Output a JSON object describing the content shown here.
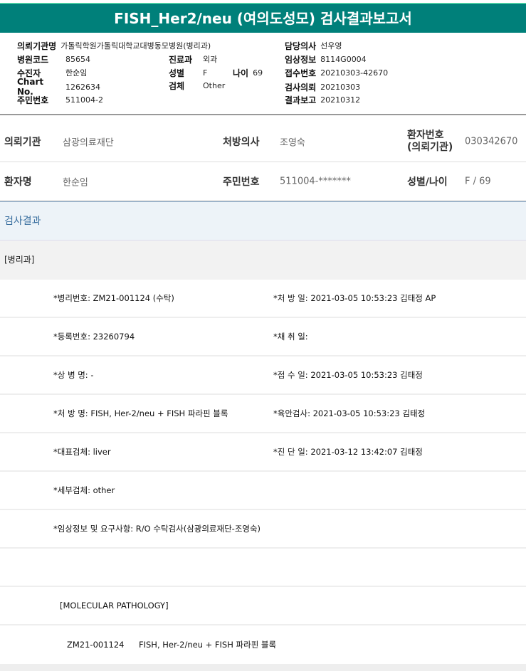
{
  "title": "FISH_Her2/neu (여의도성모) 검사결과보고서",
  "info": {
    "hospital_name_label": "의뢰기관명",
    "hospital_name": "가톨릭학원가톨릭대학교대병동모병원(병리과)",
    "hospital_code_label": "병원코드",
    "hospital_code": "85654",
    "patient_label": "수진자",
    "patient": "한순임",
    "chart_label": "Chart No.",
    "chart": "1262634",
    "rrn_label": "주민번호",
    "rrn": "511004-2",
    "dept_label": "진료과",
    "dept": "외과",
    "sex_label": "성별",
    "sex": "F",
    "age_label": "나이",
    "age": "69",
    "specimen_label": "검체",
    "specimen": "Other",
    "doctor_label": "담당의사",
    "doctor": "선우영",
    "clinical_label": "임상정보",
    "clinical": "8114G0004",
    "receipt_label": "접수번호",
    "receipt": "20210303-42670",
    "request_label": "검사의뢰",
    "request": "20210303",
    "report_label": "결과보고",
    "report": "20210312"
  },
  "patient": {
    "org_label": "의뢰기관",
    "org": "삼광의료재단",
    "presc_label": "처방의사",
    "presc": "조영숙",
    "pno_label1": "환자번호",
    "pno_label2": "(의뢰기관)",
    "pno": "030342670",
    "name_label": "환자명",
    "name": "한순임",
    "rrn_label": "주민번호",
    "rrn": "511004-*******",
    "sexage_label": "성별/나이",
    "sexage": "F / 69"
  },
  "section": "검사결과",
  "department": "[병리과]",
  "rows": [
    {
      "left": "*병리번호: ZM21-001124 (수탁)",
      "right": "*처 방 일: 2021-03-05 10:53:23  김태정 AP"
    },
    {
      "left": "*등록번호: 23260794",
      "right": "*채 취 일:"
    },
    {
      "left": "*상 병 명: -",
      "right": "*접 수 일: 2021-03-05 10:53:23  김태정"
    },
    {
      "left": "*처 방 명: FISH, Her-2/neu + FISH 파라핀 블록",
      "right": "*육안검사: 2021-03-05 10:53:23  김태정"
    },
    {
      "left": "*대표검체: liver",
      "right": "*진 단 일: 2021-03-12 13:42:07  김태정"
    },
    {
      "left": "*세부검체: other",
      "right": ""
    },
    {
      "left": "*임상정보 및 요구사항: R/O 수탁검사(삼광의료재단-조영숙)",
      "right": ""
    },
    {
      "left": "",
      "right": ""
    }
  ],
  "molecular": "[MOLECULAR PATHOLOGY]",
  "result_line": {
    "id": "ZM21-001124",
    "name": "FISH, Her-2/neu + FISH 파라핀 블록"
  }
}
